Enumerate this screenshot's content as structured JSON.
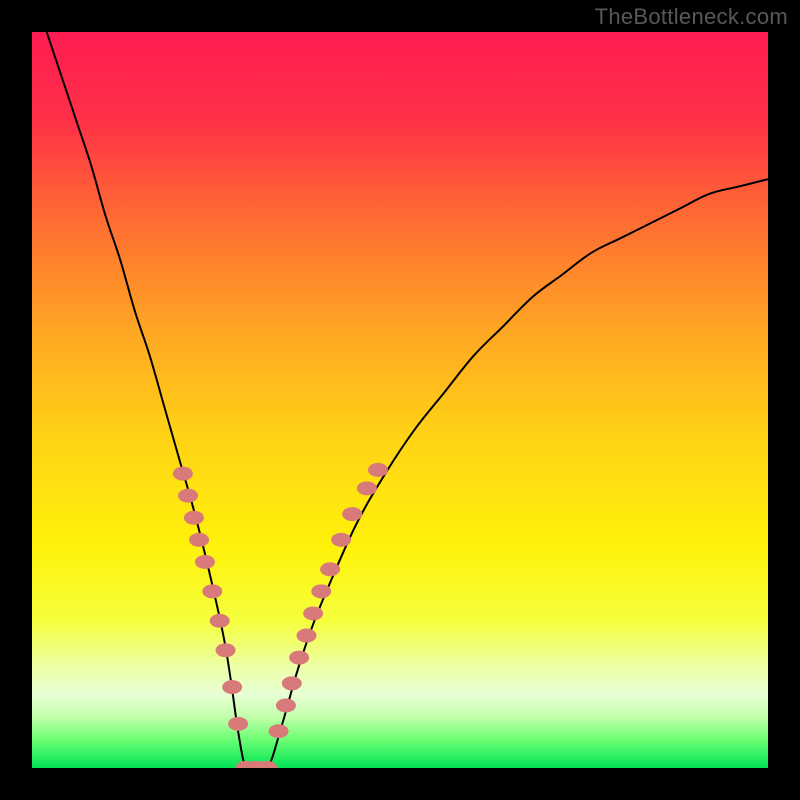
{
  "watermark": "TheBottleneck.com",
  "chart_data": {
    "type": "line",
    "title": "",
    "xlabel": "",
    "ylabel": "",
    "xlim": [
      0,
      100
    ],
    "ylim": [
      0,
      100
    ],
    "grid": false,
    "legend": false,
    "curve": {
      "name": "bottleneck-curve",
      "x": [
        2,
        4,
        6,
        8,
        10,
        12,
        14,
        16,
        18,
        20,
        22,
        24,
        26,
        27,
        28,
        29,
        30,
        32,
        34,
        36,
        38,
        40,
        44,
        48,
        52,
        56,
        60,
        64,
        68,
        72,
        76,
        80,
        84,
        88,
        92,
        96,
        100
      ],
      "y": [
        100,
        94,
        88,
        82,
        75,
        69,
        62,
        56,
        49,
        42,
        35,
        27,
        18,
        12,
        5,
        0,
        0,
        0,
        6,
        13,
        19,
        24,
        33,
        40,
        46,
        51,
        56,
        60,
        64,
        67,
        70,
        72,
        74,
        76,
        78,
        79,
        80
      ]
    },
    "marker_clusters": [
      {
        "name": "left-cluster",
        "points": [
          {
            "x": 20.5,
            "y": 40.0
          },
          {
            "x": 21.2,
            "y": 37.0
          },
          {
            "x": 22.0,
            "y": 34.0
          },
          {
            "x": 22.7,
            "y": 31.0
          },
          {
            "x": 23.5,
            "y": 28.0
          },
          {
            "x": 24.5,
            "y": 24.0
          },
          {
            "x": 25.5,
            "y": 20.0
          },
          {
            "x": 26.3,
            "y": 16.0
          },
          {
            "x": 27.2,
            "y": 11.0
          },
          {
            "x": 28.0,
            "y": 6.0
          }
        ]
      },
      {
        "name": "valley-cluster",
        "points": [
          {
            "x": 29.0,
            "y": 0.0
          },
          {
            "x": 30.0,
            "y": 0.0
          },
          {
            "x": 31.0,
            "y": 0.0
          },
          {
            "x": 32.0,
            "y": 0.0
          }
        ]
      },
      {
        "name": "right-cluster",
        "points": [
          {
            "x": 33.5,
            "y": 5.0
          },
          {
            "x": 34.5,
            "y": 8.5
          },
          {
            "x": 35.3,
            "y": 11.5
          },
          {
            "x": 36.3,
            "y": 15.0
          },
          {
            "x": 37.3,
            "y": 18.0
          },
          {
            "x": 38.2,
            "y": 21.0
          },
          {
            "x": 39.3,
            "y": 24.0
          },
          {
            "x": 40.5,
            "y": 27.0
          },
          {
            "x": 42.0,
            "y": 31.0
          },
          {
            "x": 43.5,
            "y": 34.5
          },
          {
            "x": 45.5,
            "y": 38.0
          },
          {
            "x": 47.0,
            "y": 40.5
          }
        ]
      }
    ],
    "gradient_stops": [
      {
        "pos": 0.0,
        "color": "#ff1b52"
      },
      {
        "pos": 0.12,
        "color": "#ff3147"
      },
      {
        "pos": 0.25,
        "color": "#ff6a33"
      },
      {
        "pos": 0.4,
        "color": "#ffa424"
      },
      {
        "pos": 0.55,
        "color": "#ffd315"
      },
      {
        "pos": 0.7,
        "color": "#fff20a"
      },
      {
        "pos": 0.8,
        "color": "#f5ff3c"
      },
      {
        "pos": 0.86,
        "color": "#edffa3"
      },
      {
        "pos": 0.9,
        "color": "#e8ffd4"
      },
      {
        "pos": 0.93,
        "color": "#c3ffac"
      },
      {
        "pos": 0.96,
        "color": "#6fff75"
      },
      {
        "pos": 1.0,
        "color": "#00e455"
      }
    ],
    "marker_style": {
      "fill": "#d97a7a",
      "rx": 10,
      "ry": 7
    }
  }
}
